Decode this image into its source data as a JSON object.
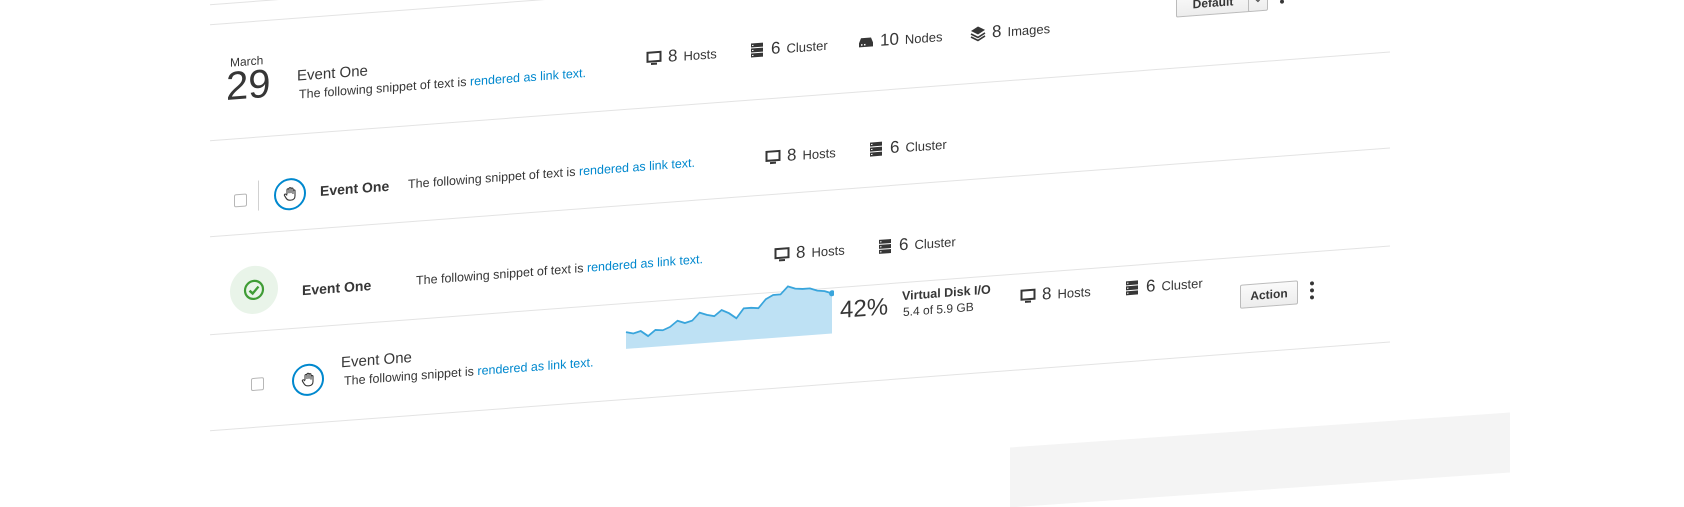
{
  "toolbar": {
    "dropdown_value": "Default"
  },
  "rows": [
    {
      "date_month": "March",
      "date_day": "29",
      "title": "Event One",
      "desc_prefix": "The following snippet of text is ",
      "desc_link": "rendered as link text.",
      "stats": [
        {
          "icon": "monitor-icon",
          "num": "8",
          "label": "Hosts"
        },
        {
          "icon": "cluster-icon",
          "num": "6",
          "label": "Cluster"
        },
        {
          "icon": "nodes-icon",
          "num": "10",
          "label": "Nodes"
        },
        {
          "icon": "images-icon",
          "num": "8",
          "label": "Images"
        }
      ]
    },
    {
      "title": "Event One",
      "desc_prefix": "The following snippet of text is ",
      "desc_link": "rendered as link text.",
      "stats": [
        {
          "icon": "monitor-icon",
          "num": "8",
          "label": "Hosts"
        },
        {
          "icon": "cluster-icon",
          "num": "6",
          "label": "Cluster"
        }
      ]
    },
    {
      "title": "Event One",
      "desc_prefix": "The following snippet of text is ",
      "desc_link": "rendered as link text.",
      "stats": [
        {
          "icon": "monitor-icon",
          "num": "8",
          "label": "Hosts"
        },
        {
          "icon": "cluster-icon",
          "num": "6",
          "label": "Cluster"
        }
      ]
    },
    {
      "title": "Event One",
      "desc_prefix": "The following snippet is ",
      "desc_link": "rendered as link text.",
      "percent": "42%",
      "metric_title": "Virtual Disk I/O",
      "metric_sub": "5.4 of 5.9 GB",
      "stats": [
        {
          "icon": "monitor-icon",
          "num": "8",
          "label": "Hosts"
        },
        {
          "icon": "cluster-icon",
          "num": "6",
          "label": "Cluster"
        }
      ],
      "action_label": "Action"
    }
  ],
  "colors": {
    "link": "#0088ce",
    "success": "#3f9c35",
    "success_bg": "#e9f4e9",
    "spark_line": "#39a5dc",
    "spark_fill": "#bee1f4"
  },
  "sparkline": [
    18,
    16,
    18,
    12,
    18,
    17,
    20,
    26,
    23,
    25,
    33,
    30,
    28,
    34,
    30,
    24,
    34,
    34,
    33,
    42,
    46,
    46,
    54,
    51,
    50,
    50,
    47,
    46,
    43
  ]
}
